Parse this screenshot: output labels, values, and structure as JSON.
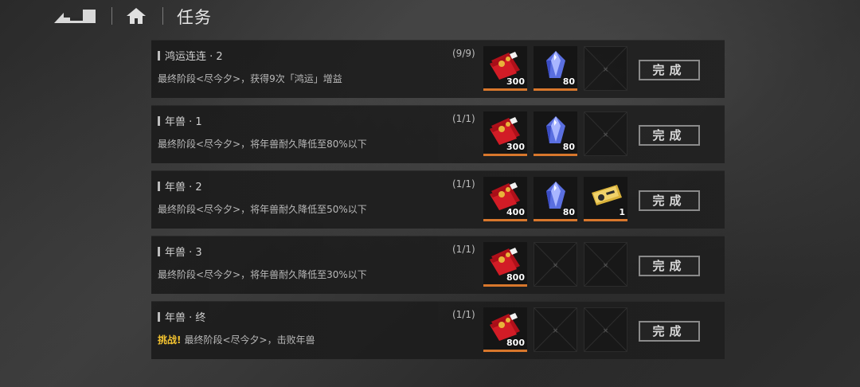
{
  "header": {
    "title": "任务"
  },
  "tasks": [
    {
      "name": "鸿运连连 · 2",
      "progress": "(9/9)",
      "challenge_prefix": "",
      "description": "最终阶段<尽今夕>，获得9次「鸿运」增益",
      "rewards": [
        {
          "icon": "red-envelope-icon",
          "qty": "300"
        },
        {
          "icon": "blue-crystal-icon",
          "qty": "80"
        },
        {
          "icon": "empty-slot",
          "qty": ""
        }
      ],
      "button": "完成"
    },
    {
      "name": "年兽 · 1",
      "progress": "(1/1)",
      "challenge_prefix": "",
      "description": "最终阶段<尽今夕>，将年兽耐久降低至80%以下",
      "rewards": [
        {
          "icon": "red-envelope-icon",
          "qty": "300"
        },
        {
          "icon": "blue-crystal-icon",
          "qty": "80"
        },
        {
          "icon": "empty-slot",
          "qty": ""
        }
      ],
      "button": "完成"
    },
    {
      "name": "年兽 · 2",
      "progress": "(1/1)",
      "challenge_prefix": "",
      "description": "最终阶段<尽今夕>，将年兽耐久降低至50%以下",
      "rewards": [
        {
          "icon": "red-envelope-icon",
          "qty": "400"
        },
        {
          "icon": "blue-crystal-icon",
          "qty": "80"
        },
        {
          "icon": "gold-ticket-icon",
          "qty": "1"
        }
      ],
      "button": "完成"
    },
    {
      "name": "年兽 · 3",
      "progress": "(1/1)",
      "challenge_prefix": "",
      "description": "最终阶段<尽今夕>，将年兽耐久降低至30%以下",
      "rewards": [
        {
          "icon": "red-envelope-icon",
          "qty": "800"
        },
        {
          "icon": "empty-slot",
          "qty": ""
        },
        {
          "icon": "empty-slot",
          "qty": ""
        }
      ],
      "button": "完成"
    },
    {
      "name": "年兽 · 终",
      "progress": "(1/1)",
      "challenge_prefix": "挑战!",
      "description": "最终阶段<尽今夕>，击败年兽",
      "rewards": [
        {
          "icon": "red-envelope-icon",
          "qty": "800"
        },
        {
          "icon": "empty-slot",
          "qty": ""
        },
        {
          "icon": "empty-slot",
          "qty": ""
        }
      ],
      "button": "完成"
    }
  ]
}
